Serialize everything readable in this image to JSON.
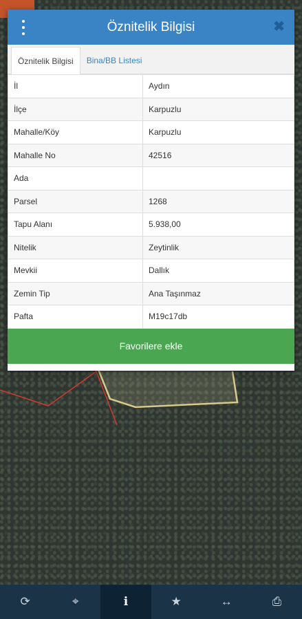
{
  "dialog": {
    "title": "Öznitelik Bilgisi",
    "close_glyph": "✖",
    "tabs": [
      {
        "label": "Öznitelik Bilgisi",
        "active": true
      },
      {
        "label": "Bina/BB Listesi",
        "active": false
      }
    ],
    "rows": [
      {
        "key": "İl",
        "value": "Aydın"
      },
      {
        "key": "İlçe",
        "value": "Karpuzlu"
      },
      {
        "key": "Mahalle/Köy",
        "value": "Karpuzlu"
      },
      {
        "key": "Mahalle No",
        "value": "42516"
      },
      {
        "key": "Ada",
        "value": ""
      },
      {
        "key": "Parsel",
        "value": "1268"
      },
      {
        "key": "Tapu Alanı",
        "value": "5.938,00"
      },
      {
        "key": "Nitelik",
        "value": "Zeytinlik"
      },
      {
        "key": "Mevkii",
        "value": "Dallık"
      },
      {
        "key": "Zemin Tip",
        "value": "Ana Taşınmaz"
      },
      {
        "key": "Pafta",
        "value": "M19c17db"
      }
    ],
    "favorite_button": "Favorilere ekle"
  },
  "toolbar": {
    "buttons": [
      {
        "icon": "refresh-icon",
        "glyph": "⟳"
      },
      {
        "icon": "crosshair-icon",
        "glyph": "⌖"
      },
      {
        "icon": "info-icon",
        "glyph": "i",
        "active": true
      },
      {
        "icon": "star-icon",
        "glyph": "★"
      },
      {
        "icon": "measure-icon",
        "glyph": "↔"
      },
      {
        "icon": "print-icon",
        "glyph": "⎙"
      }
    ]
  },
  "colors": {
    "header": "#3a84c6",
    "favorite": "#4aa651",
    "toolbar": "#1a3347",
    "parcel_outline": "#d9c98a",
    "boundary_line": "#d23a2f"
  }
}
